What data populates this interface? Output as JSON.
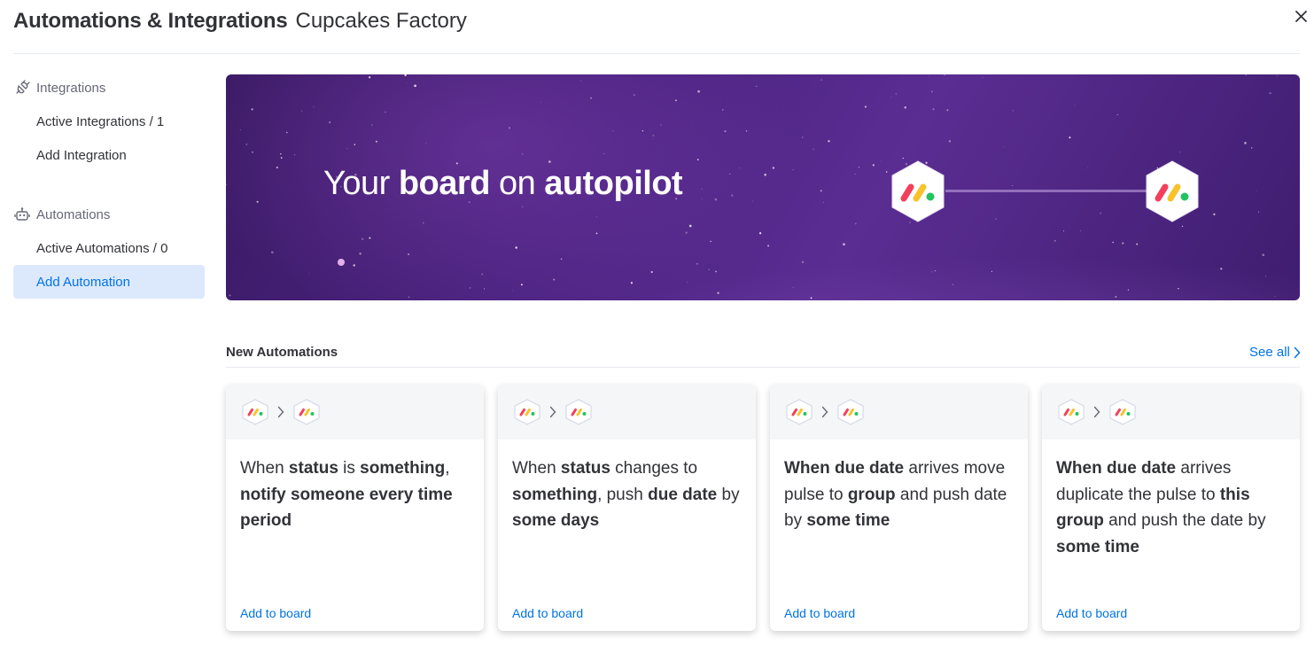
{
  "header": {
    "title": "Automations & Integrations",
    "board_name": "Cupcakes Factory"
  },
  "sidebar": {
    "integrations": {
      "label": "Integrations",
      "icon": "plug-icon",
      "items": [
        {
          "label": "Active Integrations / 1"
        },
        {
          "label": "Add Integration"
        }
      ]
    },
    "automations": {
      "label": "Automations",
      "icon": "robot-icon",
      "items": [
        {
          "label": "Active Automations / 0"
        },
        {
          "label": "Add Automation",
          "active": true
        }
      ]
    }
  },
  "banner": {
    "text_1": "Your ",
    "text_bold_1": "board",
    "text_2": " on ",
    "text_bold_2": "autopilot",
    "logo_icon": "monday-logo-icon"
  },
  "new_automations": {
    "title": "New Automations",
    "see_all": "See all",
    "add_label": "Add to board",
    "cards": [
      {
        "parts": [
          {
            "t": "When ",
            "b": false
          },
          {
            "t": "status",
            "b": true
          },
          {
            "t": " is ",
            "b": false
          },
          {
            "t": "something",
            "b": true
          },
          {
            "t": ", ",
            "b": false
          },
          {
            "t": "notify someone",
            "b": true
          },
          {
            "t": " ",
            "b": false
          },
          {
            "t": "every time period",
            "b": true
          }
        ]
      },
      {
        "parts": [
          {
            "t": "When ",
            "b": false
          },
          {
            "t": "status",
            "b": true
          },
          {
            "t": " changes to ",
            "b": false
          },
          {
            "t": "something",
            "b": true
          },
          {
            "t": ", push ",
            "b": false
          },
          {
            "t": "due date",
            "b": true
          },
          {
            "t": " by ",
            "b": false
          },
          {
            "t": "some days",
            "b": true
          }
        ]
      },
      {
        "parts": [
          {
            "t": "When",
            "b": true
          },
          {
            "t": " ",
            "b": false
          },
          {
            "t": "due date",
            "b": true
          },
          {
            "t": " arrives move pulse to ",
            "b": false
          },
          {
            "t": "group",
            "b": true
          },
          {
            "t": " and push date by ",
            "b": false
          },
          {
            "t": "some time",
            "b": true
          }
        ]
      },
      {
        "parts": [
          {
            "t": "When",
            "b": true
          },
          {
            "t": " ",
            "b": false
          },
          {
            "t": "due date",
            "b": true
          },
          {
            "t": " arrives duplicate the pulse to ",
            "b": false
          },
          {
            "t": "this group",
            "b": true
          },
          {
            "t": " and push the date by ",
            "b": false
          },
          {
            "t": "some time",
            "b": true
          }
        ]
      }
    ]
  },
  "colors": {
    "accent": "#0073ea",
    "active_bg": "#dce9fc",
    "logo_red": "#f33f5b",
    "logo_yellow": "#f8c22a",
    "logo_green": "#22c35f"
  }
}
